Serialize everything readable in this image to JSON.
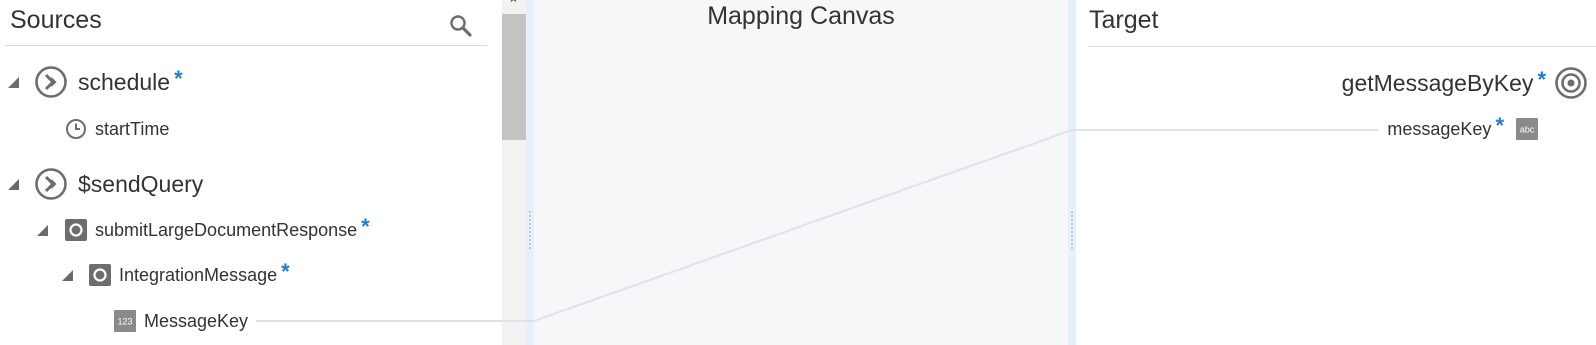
{
  "sources": {
    "title": "Sources",
    "search_icon": "search-icon",
    "nodes": [
      {
        "label": "schedule",
        "required": "*",
        "icon": "request-icon"
      },
      {
        "label": "startTime",
        "icon": "clock-icon"
      },
      {
        "label": "$sendQuery",
        "icon": "request-icon"
      },
      {
        "label": "submitLargeDocumentResponse",
        "required": "*",
        "icon": "complex-element-icon"
      },
      {
        "label": "IntegrationMessage",
        "required": "*",
        "icon": "complex-element-icon"
      },
      {
        "label": "MessageKey",
        "icon": "number-type-icon",
        "type_badge": "123"
      }
    ]
  },
  "canvas": {
    "title": "Mapping Canvas"
  },
  "target": {
    "title": "Target",
    "nodes": [
      {
        "label": "getMessageByKey",
        "required": "*",
        "icon": "target-icon"
      },
      {
        "label": "messageKey",
        "required": "*",
        "icon": "string-type-icon",
        "type_badge": "abc"
      }
    ]
  },
  "scrollbar": {
    "up_arrow": "⌃"
  },
  "colors": {
    "required_star": "#1f7dd1",
    "icon_gray": "#6d6d6d",
    "mapping_line": "#dde3ea",
    "canvas_bg": "#f6f7f8",
    "splitter": "#e7f0fa"
  }
}
